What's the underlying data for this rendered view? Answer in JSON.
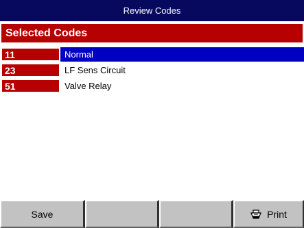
{
  "window": {
    "title": "Review Codes"
  },
  "section": {
    "title": "Selected Codes"
  },
  "codes": [
    {
      "code": "11",
      "description": "Normal",
      "selected": true
    },
    {
      "code": "23",
      "description": "LF Sens Circuit",
      "selected": false
    },
    {
      "code": "51",
      "description": "Valve Relay",
      "selected": false
    }
  ],
  "buttons": {
    "save_label": "Save",
    "blank_1_label": "",
    "blank_2_label": "",
    "print_label": "Print",
    "print_icon": "printer-icon"
  },
  "colors": {
    "titlebar": "#06095e",
    "header_red": "#b70000",
    "selection_blue": "#0000c3",
    "button_gray": "#c2c2c2"
  }
}
